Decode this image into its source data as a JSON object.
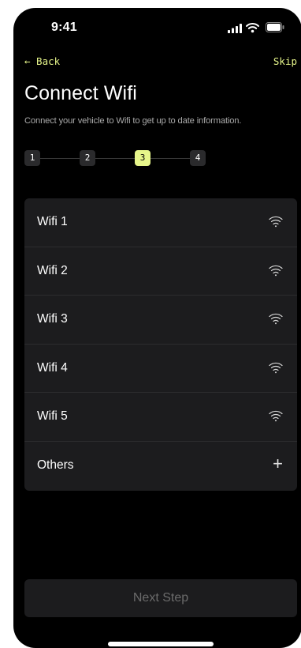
{
  "status_bar": {
    "time": "9:41",
    "signal_icon": "signal-bars-icon",
    "wifi_icon": "wifi-icon",
    "battery_icon": "battery-icon"
  },
  "nav": {
    "back_label": "← Back",
    "skip_label": "Skip"
  },
  "header": {
    "title": "Connect Wifi",
    "subtitle": "Connect your vehicle to Wifi to get up to date information."
  },
  "stepper": {
    "current_step": 3,
    "steps": [
      {
        "label": "1"
      },
      {
        "label": "2"
      },
      {
        "label": "3"
      },
      {
        "label": "4"
      }
    ]
  },
  "networks": [
    {
      "label": "Wifi 1",
      "icon": "wifi-icon"
    },
    {
      "label": "Wifi 2",
      "icon": "wifi-icon"
    },
    {
      "label": "Wifi 3",
      "icon": "wifi-icon"
    },
    {
      "label": "Wifi 4",
      "icon": "wifi-icon"
    },
    {
      "label": "Wifi 5",
      "icon": "wifi-icon"
    },
    {
      "label": "Others",
      "icon": "plus-icon",
      "plus_glyph": "+"
    }
  ],
  "footer": {
    "next_label": "Next Step"
  },
  "colors": {
    "accent": "#e6f58a",
    "background": "#000000",
    "card": "#1c1c1e",
    "divider": "#2c2c2e",
    "muted_text": "#a9a9a9"
  }
}
